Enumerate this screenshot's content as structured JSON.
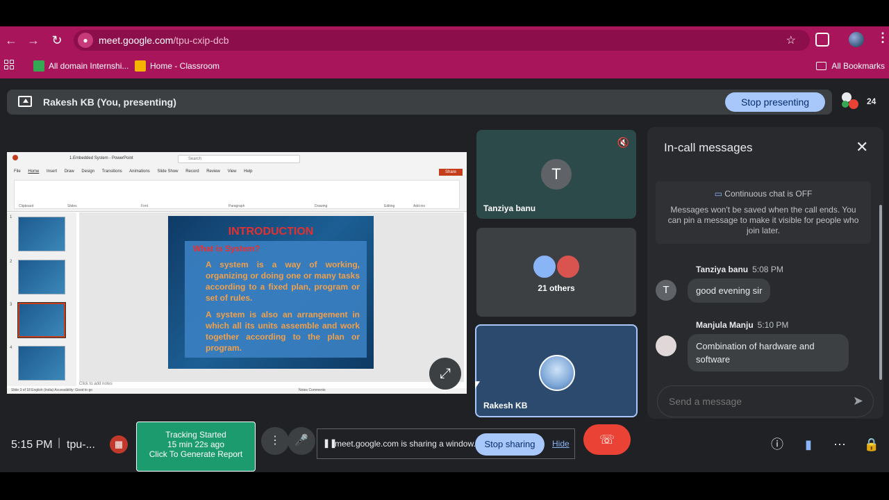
{
  "browser": {
    "url_host": "meet.google.com",
    "url_path": "/tpu-cxip-dcb",
    "bookmarks": [
      {
        "label": "All domain Internshi...",
        "color": "#34a853"
      },
      {
        "label": "Home - Classroom",
        "color": "#f4b400"
      }
    ],
    "all_bookmarks": "All Bookmarks"
  },
  "presenting_bar": {
    "title": "Rakesh KB (You, presenting)",
    "stop_button": "Stop presenting",
    "participant_count": "24"
  },
  "shared_screen": {
    "app_title": "1.Embedded System  -  PowerPoint",
    "search_placeholder": "Search",
    "tabs": [
      "File",
      "Home",
      "Insert",
      "Draw",
      "Design",
      "Transitions",
      "Animations",
      "Slide Show",
      "Record",
      "Review",
      "View",
      "Help"
    ],
    "share_label": "Share",
    "tool_groups": [
      "Clipboard",
      "Slides",
      "Font",
      "Paragraph",
      "Drawing",
      "Editing",
      "Add-ins"
    ],
    "thumb_numbers": [
      "1",
      "2",
      "3",
      "4"
    ],
    "slide": {
      "heading": "INTRODUCTION",
      "subheading": "What is System?",
      "para1": "A system is a way of working, organizing or doing one or many tasks according to a fixed plan, program or set of rules.",
      "para2": "A system is also an arrangement in which all its units assemble and work together according to the plan or program."
    },
    "notes_placeholder": "Click to add notes",
    "status_left": "Slide 3 of 18    English (India)    Accessibility: Good to go",
    "status_right": "Notes    Comments"
  },
  "tiles": [
    {
      "name": "Tanziya banu",
      "initial": "T",
      "muted": true
    },
    {
      "name": "21 others"
    },
    {
      "name": "Rakesh KB"
    }
  ],
  "chat": {
    "title": "In-call messages",
    "notice_title": "Continuous chat is OFF",
    "notice_body": "Messages won't be saved when the call ends. You can pin a message to make it visible for people who join later.",
    "messages": [
      {
        "sender": "Tanziya banu",
        "time": "5:08 PM",
        "text": "good evening sir",
        "initial": "T"
      },
      {
        "sender": "Manjula Manju",
        "time": "5:10 PM",
        "text": "Combination of hardware and software"
      }
    ],
    "input_placeholder": "Send a message"
  },
  "bottom": {
    "time": "5:15 PM",
    "meeting_code": "tpu-...",
    "tracker_line1": "Tracking Started",
    "tracker_line2": "15 min 22s ago",
    "tracker_line3": "Click To Generate Report",
    "share_message": "meet.google.com is sharing a window.",
    "stop_sharing": "Stop sharing",
    "hide": "Hide"
  },
  "colors": {
    "browser_accent": "#a8155b",
    "meet_bg": "#202124",
    "tile_bg": "#3c4043",
    "primary_button": "#a8c7fa",
    "end_call": "#ea4335",
    "tracker": "#1c9b6e"
  }
}
